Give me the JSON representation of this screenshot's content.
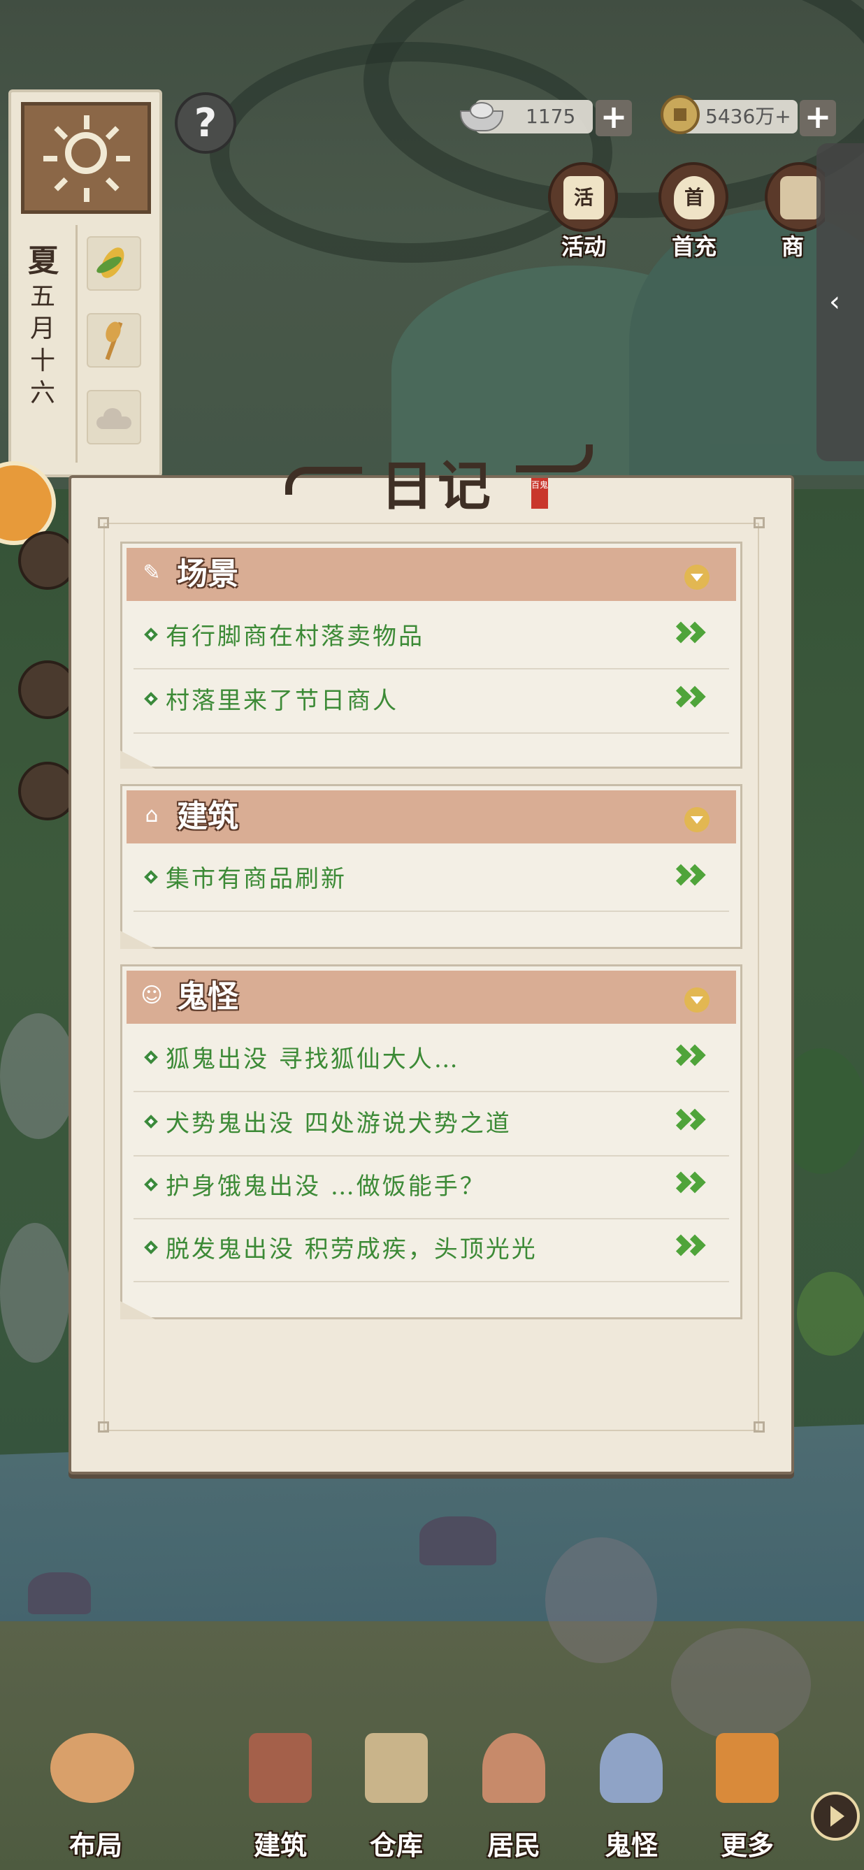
{
  "currency": {
    "silver": "1175",
    "coins": "5436万+",
    "add_symbol": "+"
  },
  "calendar": {
    "season": "夏",
    "date_chars": [
      "五",
      "月",
      "十",
      "六"
    ],
    "help": "?"
  },
  "top_icons": [
    {
      "label": "活动",
      "glyph": "活"
    },
    {
      "label": "首充",
      "glyph": "首"
    },
    {
      "label": "商",
      "glyph": ""
    }
  ],
  "side_tab": "‹",
  "diary": {
    "title": "日记",
    "seal": "百鬼",
    "sections": [
      {
        "title": "场景",
        "icon": "brush-icon",
        "items": [
          "有行脚商在村落卖物品",
          "村落里来了节日商人"
        ]
      },
      {
        "title": "建筑",
        "icon": "house-icon",
        "items": [
          "集市有商品刷新"
        ]
      },
      {
        "title": "鬼怪",
        "icon": "ghost-icon",
        "items": [
          "狐鬼出没  寻找狐仙大人…",
          "犬势鬼出没  四处游说犬势之道",
          "护身饿鬼出没  …做饭能手？",
          "脱发鬼出没  积劳成疾，头顶光光"
        ]
      }
    ]
  },
  "bottom_nav": [
    {
      "label": "布局"
    },
    {
      "label": "建筑"
    },
    {
      "label": "仓库"
    },
    {
      "label": "居民"
    },
    {
      "label": "鬼怪"
    },
    {
      "label": "更多"
    }
  ],
  "colors": {
    "section_header": "#d9ad94",
    "item_text": "#3c8a36",
    "arrow": "#4fa43a",
    "panel_bg": "#efe8da"
  }
}
